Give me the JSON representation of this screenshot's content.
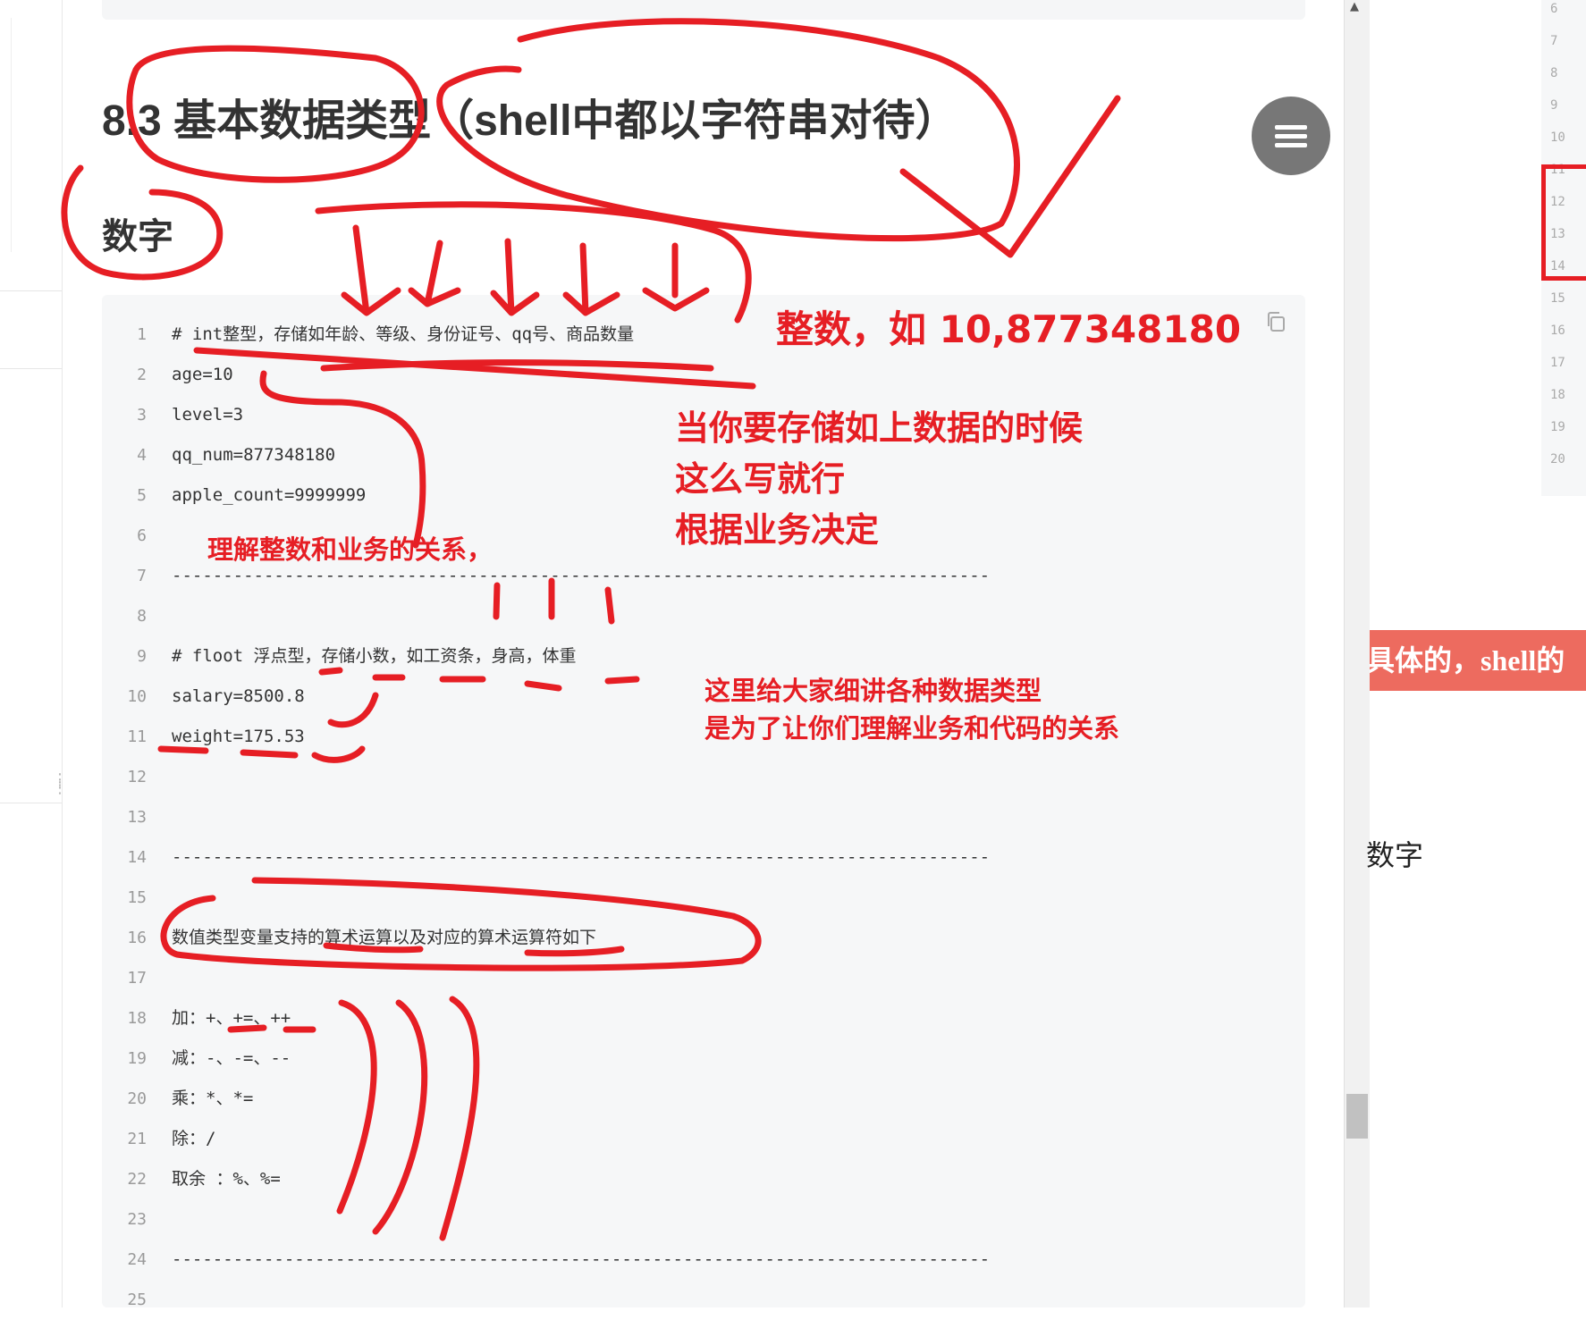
{
  "article": {
    "heading": "8.3 基本数据类型（shell中都以字符串对待）",
    "subheading": "数字"
  },
  "code_lines": [
    {
      "num": "1",
      "text": "# int整型，存储如年龄、等级、身份证号、qq号、商品数量"
    },
    {
      "num": "2",
      "text": "age=10"
    },
    {
      "num": "3",
      "text": "level=3"
    },
    {
      "num": "4",
      "text": "qq_num=877348180"
    },
    {
      "num": "5",
      "text": "apple_count=9999999"
    },
    {
      "num": "6",
      "text": ""
    },
    {
      "num": "7",
      "text": "--------------------------------------------------------------------------------"
    },
    {
      "num": "8",
      "text": ""
    },
    {
      "num": "9",
      "text": "# floot 浮点型，存储小数，如工资条，身高，体重"
    },
    {
      "num": "10",
      "text": "salary=8500.8"
    },
    {
      "num": "11",
      "text": "weight=175.53"
    },
    {
      "num": "12",
      "text": ""
    },
    {
      "num": "13",
      "text": ""
    },
    {
      "num": "14",
      "text": "--------------------------------------------------------------------------------"
    },
    {
      "num": "15",
      "text": ""
    },
    {
      "num": "16",
      "text": "数值类型变量支持的算术运算以及对应的算术运算符如下"
    },
    {
      "num": "17",
      "text": ""
    },
    {
      "num": "18",
      "text": "加：+、+=、++"
    },
    {
      "num": "19",
      "text": "减：-、-=、--"
    },
    {
      "num": "20",
      "text": "乘：*、*="
    },
    {
      "num": "21",
      "text": "除：/"
    },
    {
      "num": "22",
      "text": "取余 ：%、%="
    },
    {
      "num": "23",
      "text": ""
    },
    {
      "num": "24",
      "text": "--------------------------------------------------------------------------------"
    },
    {
      "num": "25",
      "text": ""
    }
  ],
  "annotations": {
    "integer_example": "整数，如 10,877348180",
    "store_note_1": "当你要存储如上数据的时候",
    "store_note_2": "这么写就行",
    "store_note_3": "根据业务决定",
    "understand_note": "理解整数和业务的关系，",
    "explain_note_1": "这里给大家细讲各种数据类型",
    "explain_note_2": "是为了让你们理解业务和代码的关系"
  },
  "right_panel": {
    "gutter_numbers": [
      "6",
      "7",
      "8",
      "9",
      "10",
      "11",
      "12",
      "13",
      "14",
      "15",
      "16",
      "17",
      "18",
      "19",
      "20"
    ],
    "banner_text": "具体的，shell的",
    "body_text": "数字"
  },
  "icons": {
    "menu": "hamburger-menu-icon",
    "copy": "copy-icon",
    "scroll_up": "scroll-up-arrow-icon",
    "drag": "drag-handle-icon"
  },
  "colors": {
    "annotation_red": "#e61e24",
    "code_background": "#f6f7f8",
    "banner": "#ed6b5f",
    "fab": "#777777"
  }
}
